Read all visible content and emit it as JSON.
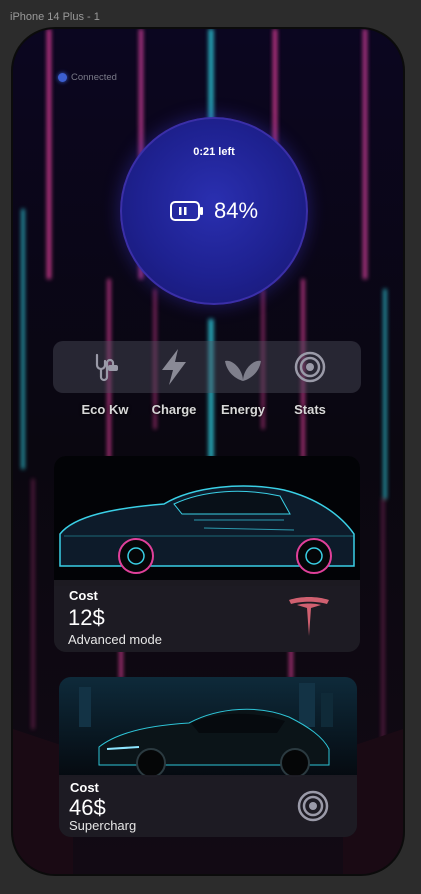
{
  "frame": {
    "title": "iPhone 14 Plus - 1"
  },
  "status": {
    "text": "Connected",
    "color": "#3c5fd0"
  },
  "battery": {
    "time_left": "0:21 left",
    "percent_text": "84%",
    "icon": "battery-icon"
  },
  "menu": [
    {
      "label": "Eco Kw",
      "icon": "plug-icon"
    },
    {
      "label": "Charge",
      "icon": "lightning-icon"
    },
    {
      "label": "Energy",
      "icon": "leaf-icon"
    },
    {
      "label": "Stats",
      "icon": "target-icon"
    }
  ],
  "cards": [
    {
      "cost_label": "Cost",
      "cost_value": "12$",
      "mode": "Advanced mode",
      "logo": "tesla-logo-icon"
    },
    {
      "cost_label": "Cost",
      "cost_value": "46$",
      "mode": "Supercharg",
      "logo": "target-icon"
    }
  ],
  "colors": {
    "accent_pink": "#e0409a",
    "accent_cyan": "#2ec4d6",
    "circle": "#1e2190"
  }
}
